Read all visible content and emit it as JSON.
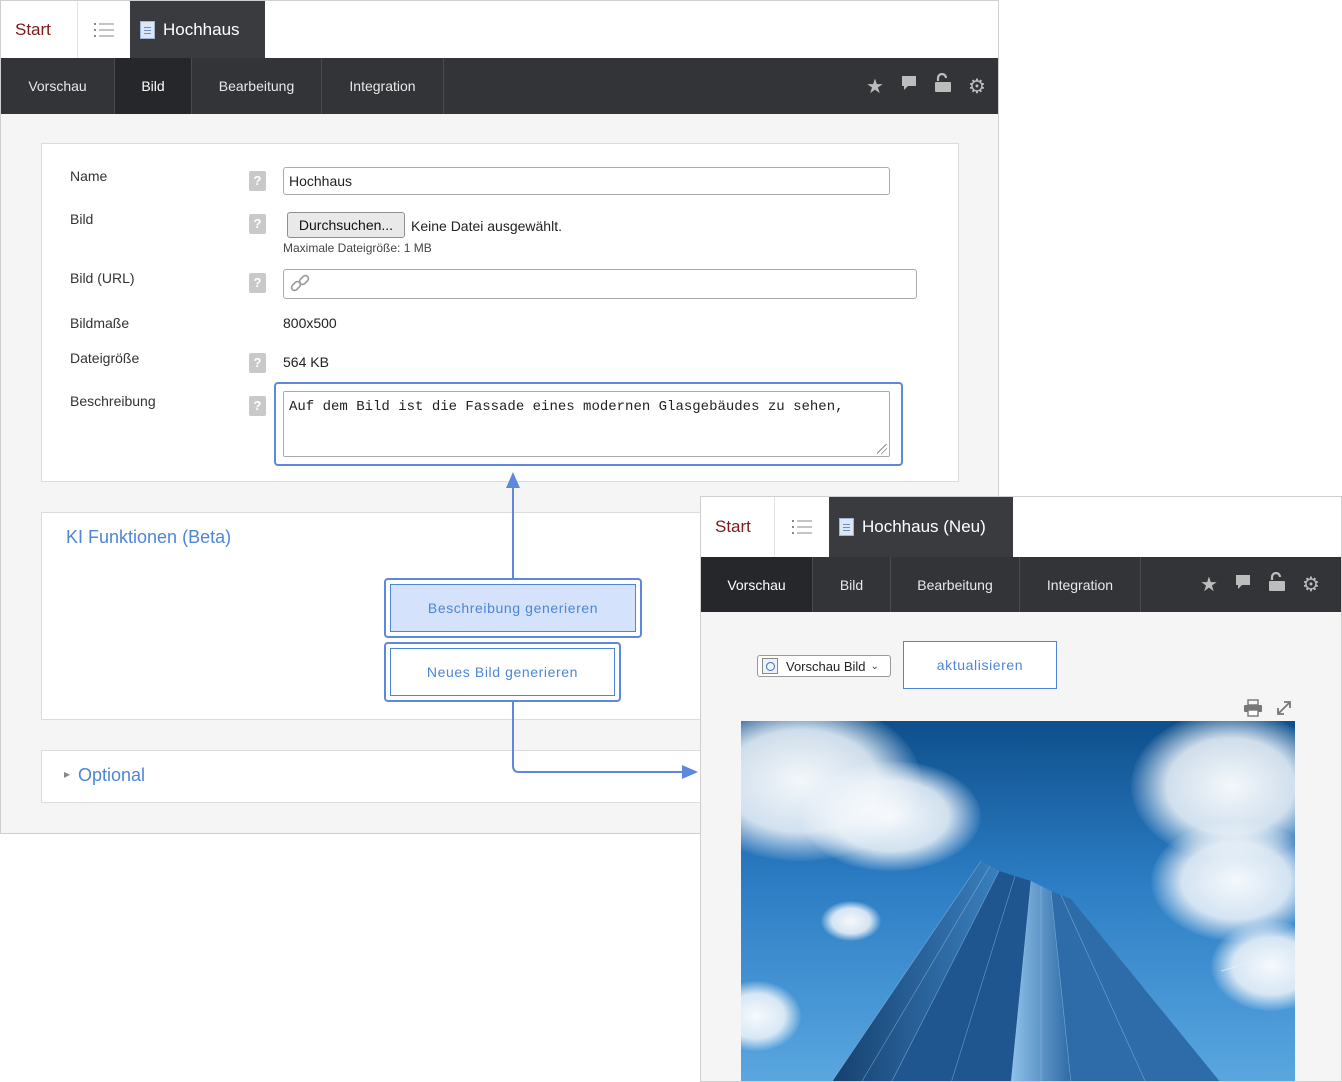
{
  "window1": {
    "tabs": {
      "start": "Start",
      "active": "Hochhaus"
    },
    "nav": [
      "Vorschau",
      "Bild",
      "Bearbeitung",
      "Integration"
    ],
    "nav_active": "Bild",
    "nav_icons": [
      "star-icon",
      "comment-icon",
      "unlock-icon",
      "gear-icon"
    ],
    "form": {
      "name_label": "Name",
      "name_value": "Hochhaus",
      "bild_label": "Bild",
      "browse_button": "Durchsuchen...",
      "no_file": "Keine Datei ausgewählt.",
      "max_size": "Maximale Dateigröße: 1 MB",
      "url_label": "Bild (URL)",
      "url_value": "",
      "dims_label": "Bildmaße",
      "dims_value": "800x500",
      "size_label": "Dateigröße",
      "size_value": "564 KB",
      "desc_label": "Beschreibung",
      "desc_value": "Auf dem Bild ist die Fassade eines modernen Glasgebäudes zu sehen,",
      "help_glyph": "?"
    },
    "ki": {
      "title": "KI Funktionen (Beta)",
      "generate_description": "Beschreibung generieren",
      "generate_image": "Neues Bild generieren"
    },
    "optional": {
      "title": "Optional",
      "arrow": "▸"
    }
  },
  "window2": {
    "tabs": {
      "start": "Start",
      "active": "Hochhaus (Neu)"
    },
    "nav": [
      "Vorschau",
      "Bild",
      "Bearbeitung",
      "Integration"
    ],
    "nav_active": "Vorschau",
    "nav_icons": [
      "star-icon",
      "comment-icon",
      "unlock-icon",
      "gear-icon"
    ],
    "select_value": "Vorschau Bild",
    "refresh_button": "aktualisieren",
    "print_icon": "print-icon",
    "expand_icon": "expand-icon"
  },
  "colors": {
    "accent": "#5d88dc",
    "nav_bg": "#333438",
    "start_text": "#7a1a1a"
  }
}
